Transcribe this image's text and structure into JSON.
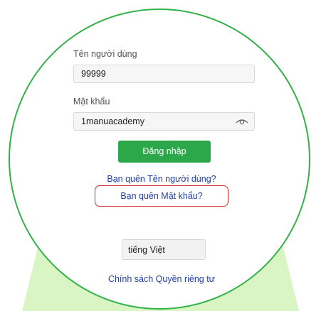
{
  "colors": {
    "accent_green": "#2ca84a",
    "frame_green": "#33b24a",
    "beam_fill": "#d9f5c4",
    "link_blue": "#1f3fa3",
    "highlight_red": "#d22b2b"
  },
  "username": {
    "label": "Tên người dùng",
    "value": "99999"
  },
  "password": {
    "label": "Mật khẩu",
    "value": "1manuacademy",
    "toggle_icon": "eye-icon"
  },
  "login_button": "Đăng nhập",
  "links": {
    "forgot_username": "Bạn quên Tên người dùng?",
    "forgot_password": "Bạn quên Mật khẩu?",
    "privacy_policy": "Chính sách Quyền riêng tư"
  },
  "language": {
    "selected": "tiếng Việt"
  }
}
